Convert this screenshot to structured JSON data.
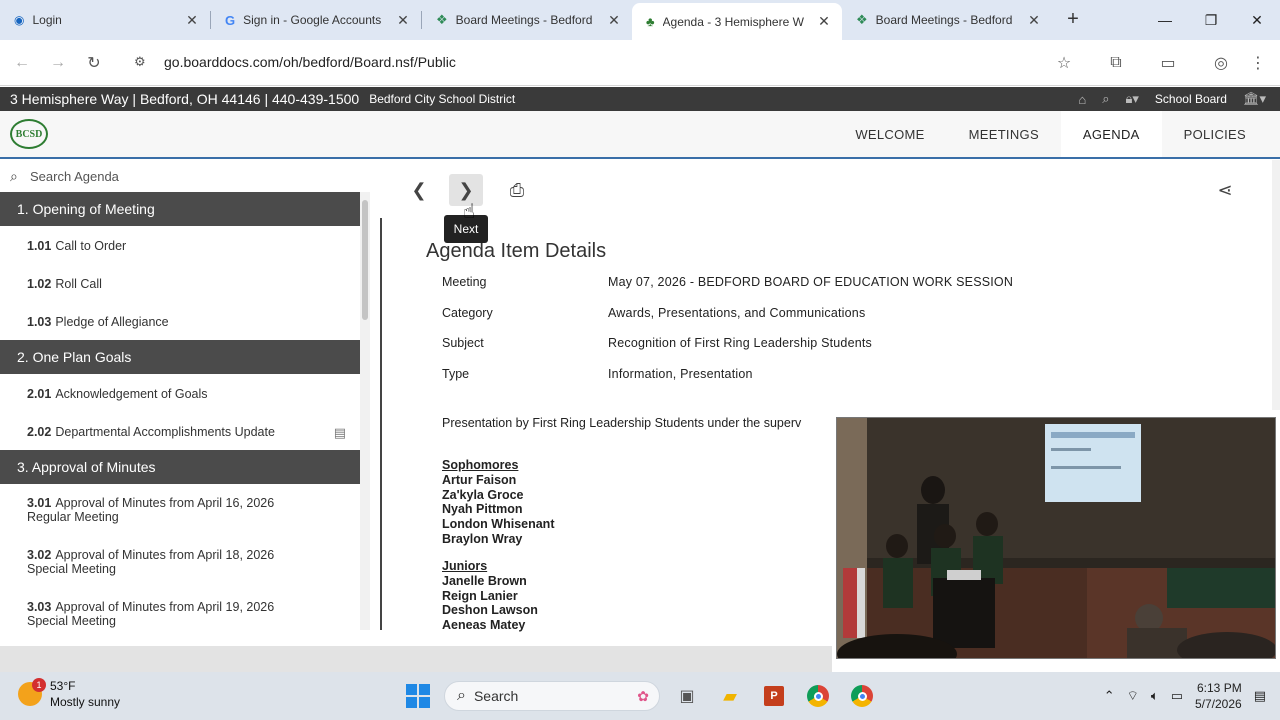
{
  "browser": {
    "tabs": [
      {
        "title": "Login",
        "active": false
      },
      {
        "title": "Sign in - Google Accounts",
        "active": false
      },
      {
        "title": "Board Meetings - Bedford",
        "active": false
      },
      {
        "title": "Agenda - 3 Hemisphere W",
        "active": true
      },
      {
        "title": "Board Meetings - Bedford",
        "active": false
      }
    ],
    "url": "go.boarddocs.com/oh/bedford/Board.nsf/Public"
  },
  "site": {
    "address": "3 Hemisphere Way | Bedford, OH 44146 | 440-439-1500",
    "district": "Bedford City School District",
    "board_label": "School Board",
    "logo_text": "BCSD",
    "nav": {
      "welcome": "WELCOME",
      "meetings": "MEETINGS",
      "agenda": "AGENDA",
      "policies": "POLICIES"
    }
  },
  "sidebar": {
    "search_placeholder": "Search Agenda",
    "categories": [
      {
        "label": "1. Opening of Meeting",
        "items": [
          {
            "num": "1.01",
            "label": "Call to Order"
          },
          {
            "num": "1.02",
            "label": "Roll Call"
          },
          {
            "num": "1.03",
            "label": "Pledge of Allegiance"
          }
        ]
      },
      {
        "label": "2. One Plan Goals",
        "items": [
          {
            "num": "2.01",
            "label": "Acknowledgement of Goals"
          },
          {
            "num": "2.02",
            "label": "Departmental Accomplishments Update"
          }
        ]
      },
      {
        "label": "3. Approval of Minutes",
        "items": [
          {
            "num": "3.01",
            "label": "Approval of Minutes from April 16, 2026",
            "label2": "Regular Meeting"
          },
          {
            "num": "3.02",
            "label": "Approval of Minutes from April 18, 2026",
            "label2": "Special Meeting"
          },
          {
            "num": "3.03",
            "label": "Approval of Minutes from April 19, 2026",
            "label2": "Special Meeting"
          }
        ]
      }
    ]
  },
  "content": {
    "tooltip": "Next",
    "heading": "Agenda Item Details",
    "details": {
      "meeting_label": "Meeting",
      "meeting_value": "May 07, 2026 - BEDFORD BOARD OF EDUCATION WORK SESSION",
      "category_label": "Category",
      "category_value": "Awards, Presentations, and Communications",
      "subject_label": "Subject",
      "subject_value": "Recognition of First Ring Leadership Students",
      "type_label": "Type",
      "type_value": "Information, Presentation"
    },
    "description": "Presentation by First Ring Leadership Students under the superv",
    "sophomores_heading": "Sophomores",
    "sophomores": [
      "Artur Faison",
      "Za'kyla Groce",
      "Nyah Pittmon",
      "London Whisenant",
      "Braylon Wray"
    ],
    "juniors_heading": "Juniors",
    "juniors": [
      "Janelle Brown",
      "Reign Lanier",
      "Deshon Lawson",
      "Aeneas Matey"
    ]
  },
  "taskbar": {
    "temperature": "53°F",
    "weather": "Mostly sunny",
    "notification_count": "1",
    "search_label": "Search",
    "time": "6:13 PM",
    "date": "5/7/2026"
  },
  "colors": {
    "category_bar": "#4b4b4b",
    "nav_underline": "#3a6fa8",
    "logo_green": "#2e7d32"
  }
}
